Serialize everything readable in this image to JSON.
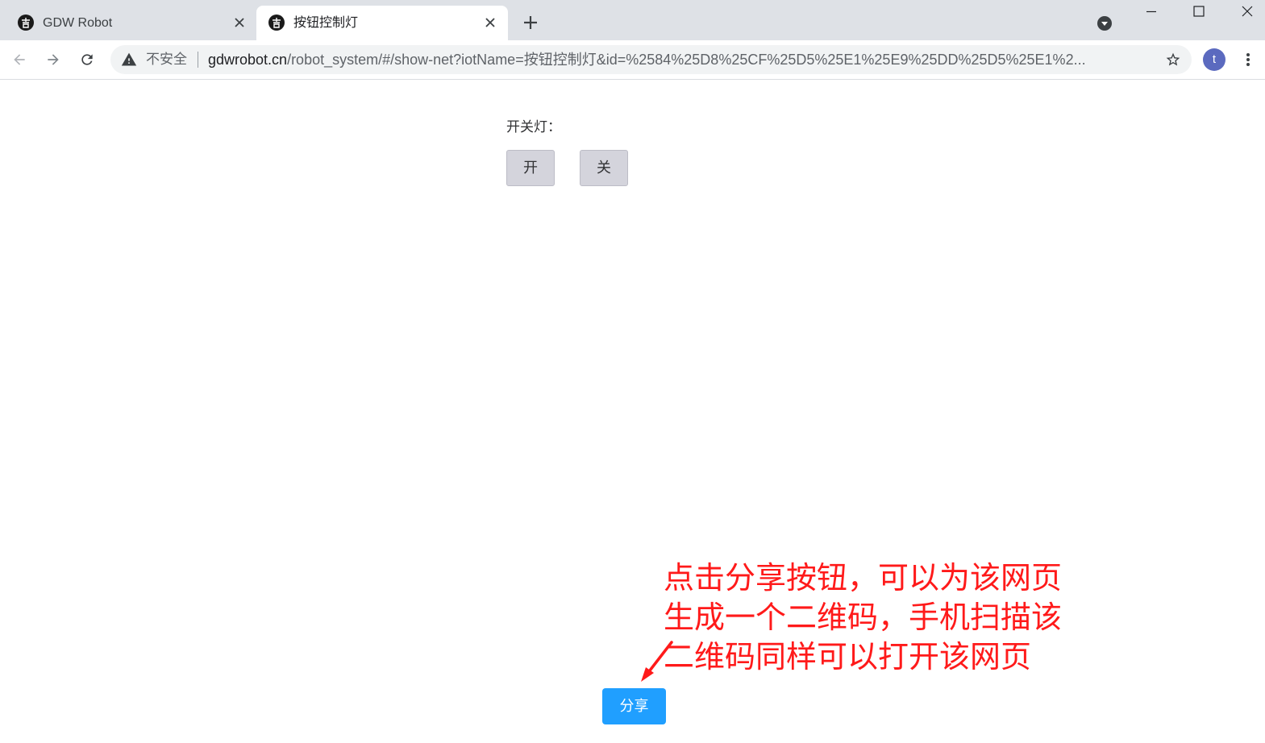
{
  "browser": {
    "tabs": [
      {
        "title": "GDW Robot",
        "active": false,
        "favicon": "gdw-favicon",
        "close_icon": "close-icon"
      },
      {
        "title": "按钮控制灯",
        "active": true,
        "favicon": "gdw-favicon",
        "close_icon": "close-icon"
      }
    ],
    "new_tab_icon": "plus-icon",
    "tab_search_icon": "chevron-down-circle-icon",
    "window_controls": [
      "minimize-icon",
      "maximize-icon",
      "close-icon"
    ],
    "nav_icons": [
      "back-arrow-icon",
      "forward-arrow-icon",
      "reload-icon"
    ],
    "omnibox": {
      "security_icon": "warning-icon",
      "security_label": "不安全",
      "url_domain": "gdwrobot.cn",
      "url_path": "/robot_system/#/show-net?iotName=按钮控制灯&id=%2584%25D8%25CF%25D5%25E1%25E9%25DD%25D5%25E1%2...",
      "bookmark_icon": "star-outline-icon"
    },
    "profile_initial": "t",
    "menu_icon": "kebab-menu-icon",
    "colors": {
      "tabstrip": "#dee1e6",
      "omnibox": "#f1f3f4",
      "avatar": "#5b6abf"
    }
  },
  "page": {
    "control_label": "开关灯：",
    "on_button": "开",
    "off_button": "关",
    "share_button": "分享",
    "colors": {
      "control_button": "#d4d4dc",
      "share_button": "#209fff"
    }
  },
  "annotation": {
    "lines": [
      "点击分享按钮，可以为该网页",
      "生成一个二维码，手机扫描该",
      "二维码同样可以打开该网页"
    ],
    "color": "#ff1a1a",
    "arrow_icon": "annotation-arrow"
  }
}
